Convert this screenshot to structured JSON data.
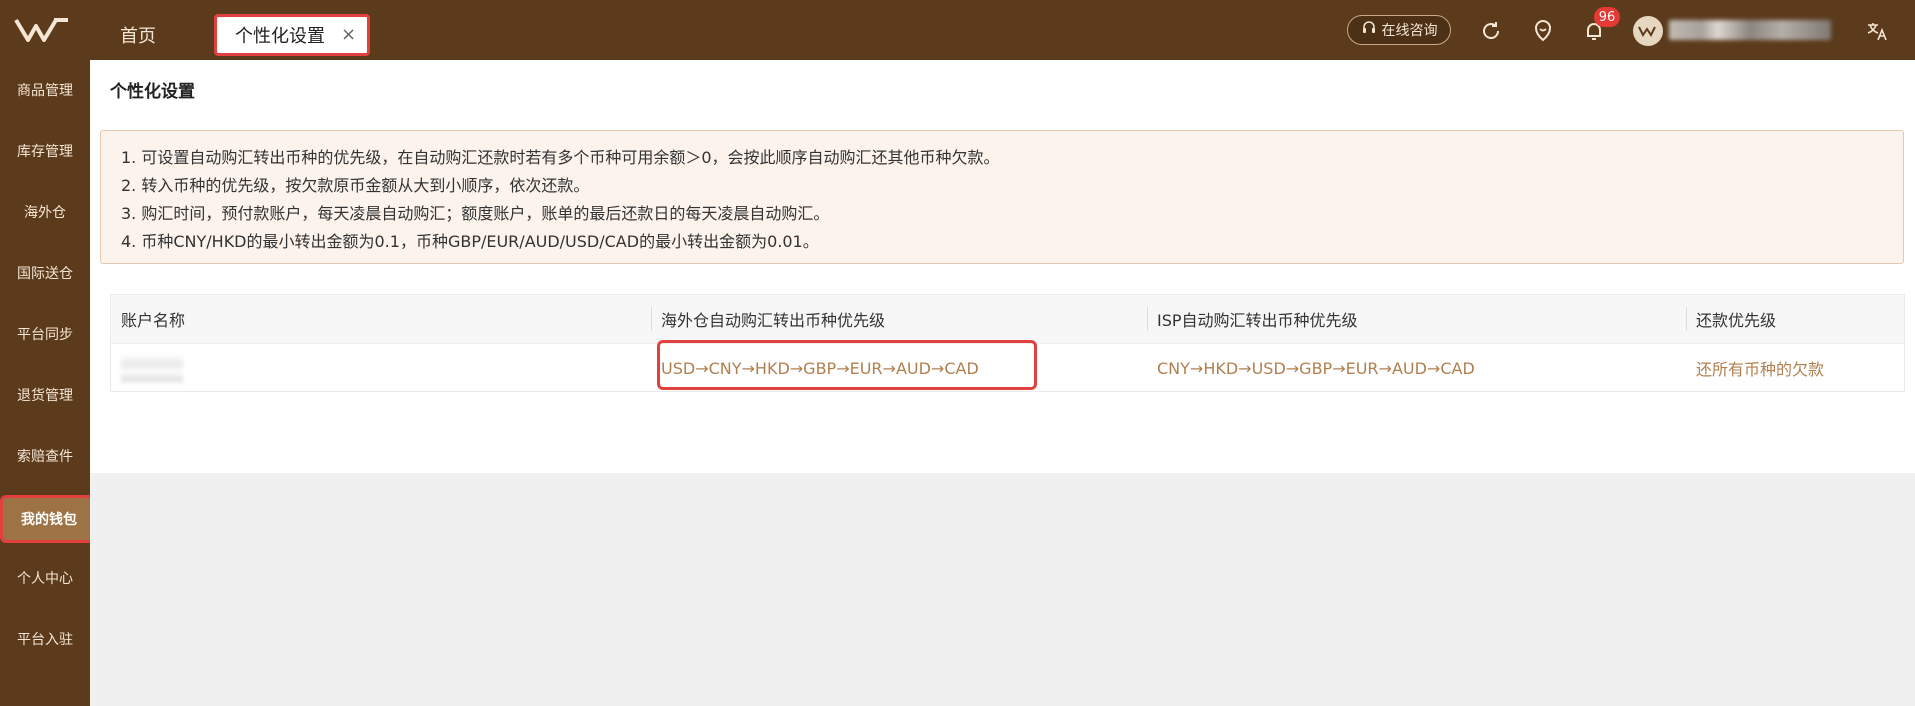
{
  "header": {
    "tabs": [
      {
        "label": "首页"
      },
      {
        "label": "个性化设置"
      }
    ],
    "consult_label": "在线咨询",
    "notification_count": "96",
    "colors": {
      "bar": "#5c3b1c",
      "accent": "#b18050",
      "highlight": "#e2403f"
    }
  },
  "sidebar": {
    "items": [
      {
        "label": "商品管理"
      },
      {
        "label": "库存管理"
      },
      {
        "label": "海外仓"
      },
      {
        "label": "国际送仓"
      },
      {
        "label": "平台同步"
      },
      {
        "label": "退货管理"
      },
      {
        "label": "索赔查件"
      },
      {
        "label": "我的钱包",
        "active": true
      },
      {
        "label": "个人中心"
      },
      {
        "label": "平台入驻"
      }
    ]
  },
  "page": {
    "title": "个性化设置",
    "notice": [
      "1. 可设置自动购汇转出币种的优先级，在自动购汇还款时若有多个币种可用余额＞0，会按此顺序自动购汇还其他币种欠款。",
      "2. 转入币种的优先级，按欠款原币金额从大到小顺序，依次还款。",
      "3. 购汇时间，预付款账户，每天凌晨自动购汇；额度账户，账单的最后还款日的每天凌晨自动购汇。",
      "4. 币种CNY/HKD的最小转出金额为0.1，币种GBP/EUR/AUD/USD/CAD的最小转出金额为0.01。"
    ],
    "table": {
      "headers": [
        "账户名称",
        "海外仓自动购汇转出币种优先级",
        "ISP自动购汇转出币种优先级",
        "还款优先级"
      ],
      "rows": [
        {
          "overseas": "USD→CNY→HKD→GBP→EUR→AUD→CAD",
          "isp": "CNY→HKD→USD→GBP→EUR→AUD→CAD",
          "repay": "还所有币种的欠款"
        }
      ]
    }
  }
}
